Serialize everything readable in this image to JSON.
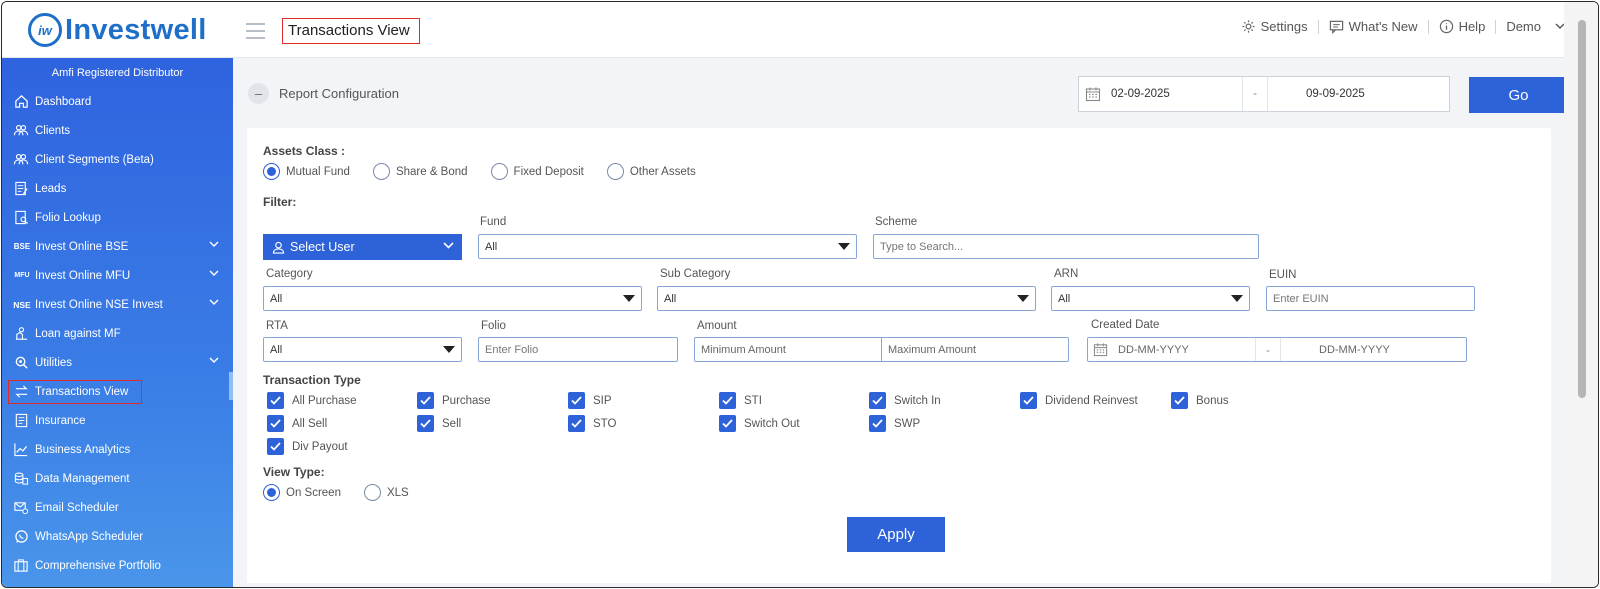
{
  "header": {
    "logo_mark": "iw",
    "logo_text": "Investwell",
    "page_title": "Transactions View",
    "settings": "Settings",
    "whats_new": "What's New",
    "help": "Help",
    "user": "Demo"
  },
  "sidebar": {
    "heading": "Amfi Registered Distributor",
    "items": [
      {
        "label": "Dashboard",
        "icon": "home-icon"
      },
      {
        "label": "Clients",
        "icon": "users-icon"
      },
      {
        "label": "Client Segments (Beta)",
        "icon": "users-icon"
      },
      {
        "label": "Leads",
        "icon": "leads-icon"
      },
      {
        "label": "Folio Lookup",
        "icon": "folio-icon"
      },
      {
        "label": "Invest Online BSE",
        "icon": "bse-icon",
        "badge": "BSE"
      },
      {
        "label": "Invest Online MFU",
        "icon": "mfu-icon",
        "badge": "MFU"
      },
      {
        "label": "Invest Online NSE Invest",
        "icon": "nse-icon",
        "badge": "NSE"
      },
      {
        "label": "Loan against MF",
        "icon": "loan-icon"
      },
      {
        "label": "Utilities",
        "icon": "utilities-icon"
      },
      {
        "label": "Transactions View",
        "icon": "transfer-icon"
      },
      {
        "label": "Insurance",
        "icon": "insurance-icon"
      },
      {
        "label": "Business Analytics",
        "icon": "analytics-icon"
      },
      {
        "label": "Data Management",
        "icon": "database-icon"
      },
      {
        "label": "Email Scheduler",
        "icon": "email-icon"
      },
      {
        "label": "WhatsApp Scheduler",
        "icon": "whatsapp-icon"
      },
      {
        "label": "Comprehensive Portfolio",
        "icon": "portfolio-icon"
      }
    ]
  },
  "main": {
    "report_config": "Report Configuration",
    "from_date": "02-09-2025",
    "date_sep": "-",
    "to_date": "09-09-2025",
    "go": "Go",
    "assets_class_label": "Assets Class :",
    "assets": [
      "Mutual Fund",
      "Share & Bond",
      "Fixed Deposit",
      "Other Assets"
    ],
    "assets_selected": "Mutual Fund",
    "filter_label": "Filter:",
    "select_user": "Select User",
    "fund_label": "Fund",
    "fund_value": "All",
    "scheme_label": "Scheme",
    "scheme_placeholder": "Type to Search...",
    "category_label": "Category",
    "category_value": "All",
    "subcategory_label": "Sub Category",
    "subcategory_value": "All",
    "arn_label": "ARN",
    "arn_value": "All",
    "euin_label": "EUIN",
    "euin_placeholder": "Enter EUIN",
    "rta_label": "RTA",
    "rta_value": "All",
    "folio_label": "Folio",
    "folio_placeholder": "Enter Folio",
    "amount_label": "Amount",
    "min_amount_placeholder": "Minimum Amount",
    "max_amount_placeholder": "Maximum Amount",
    "created_date_label": "Created Date",
    "created_from_placeholder": "DD-MM-YYYY",
    "created_sep": "-",
    "created_to_placeholder": "DD-MM-YYYY",
    "transaction_type_label": "Transaction Type",
    "transaction_types": [
      {
        "label": "All Purchase",
        "checked": true
      },
      {
        "label": "Purchase",
        "checked": true
      },
      {
        "label": "SIP",
        "checked": true
      },
      {
        "label": "STI",
        "checked": true
      },
      {
        "label": "Switch In",
        "checked": true
      },
      {
        "label": "Dividend Reinvest",
        "checked": true
      },
      {
        "label": "Bonus",
        "checked": true
      },
      {
        "label": "All Sell",
        "checked": true
      },
      {
        "label": "Sell",
        "checked": true
      },
      {
        "label": "STO",
        "checked": true
      },
      {
        "label": "Switch Out",
        "checked": true
      },
      {
        "label": "SWP",
        "checked": true
      },
      {
        "label": "Div Payout",
        "checked": true
      }
    ],
    "view_type_label": "View Type:",
    "view_types": [
      "On Screen",
      "XLS"
    ],
    "view_selected": "On Screen",
    "apply": "Apply"
  },
  "colors": {
    "primary": "#2d62d8",
    "brand": "#1f6fc9",
    "highlight_border": "#e02b2b"
  }
}
